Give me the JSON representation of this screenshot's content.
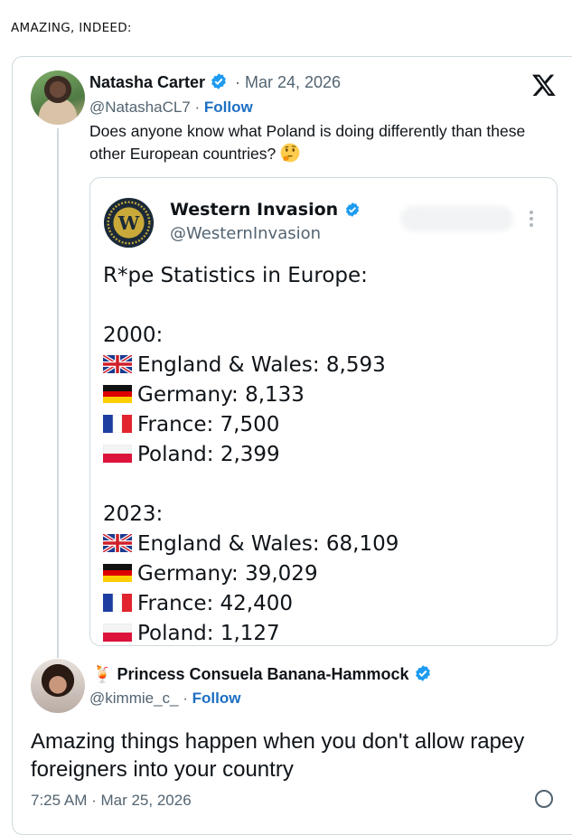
{
  "heading": "AMAZING, INDEED:",
  "tweet1": {
    "name": "Natasha Carter",
    "date": "· Mar 24, 2026",
    "handle": "@NatashaCL7",
    "separator": " · ",
    "follow": "Follow",
    "text": "Does anyone know what Poland is doing differently than these other European countries?",
    "emoji": "thinking-face-icon"
  },
  "embed": {
    "avatar_letter": "W",
    "name": "Western Invasion",
    "handle": "@WesternInvasion",
    "title": "R*pe Statistics in Europe:",
    "year1": "2000:",
    "rows1": [
      {
        "flag": "uk",
        "text": "England & Wales: 8,593"
      },
      {
        "flag": "de",
        "text": "Germany: 8,133"
      },
      {
        "flag": "fr",
        "text": "France: 7,500"
      },
      {
        "flag": "pl",
        "text": "Poland: 2,399"
      }
    ],
    "year2": "2023:",
    "rows2": [
      {
        "flag": "uk",
        "text": "England & Wales: 68,109"
      },
      {
        "flag": "de",
        "text": "Germany: 39,029"
      },
      {
        "flag": "fr",
        "text": "France: 42,400"
      },
      {
        "flag": "pl",
        "text": "Poland: 1,127"
      }
    ]
  },
  "tweet2": {
    "name_emoji": "🍹",
    "name": "Princess Consuela Banana-Hammock",
    "handle": "@kimmie_c_",
    "separator": " · ",
    "follow": "Follow",
    "text": "Amazing things happen when you don't allow rapey foreigners into your country",
    "time": "7:25 AM · Mar 25, 2026"
  },
  "colors": {
    "verified": "#1d9bf0",
    "link": "#1d6fc2",
    "muted": "#536471",
    "border": "#cfd9de"
  }
}
